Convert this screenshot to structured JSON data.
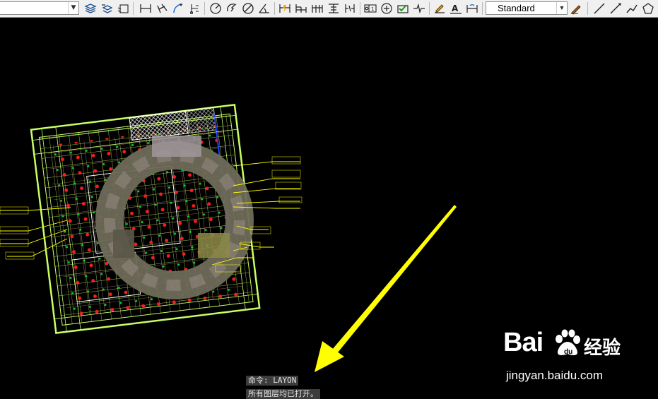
{
  "toolbar": {
    "text_style": "Standard",
    "icons": [
      "layer-properties-icon",
      "layer-previous-icon",
      "layer-state-icon",
      "dim-linear-icon",
      "dim-aligned-icon",
      "dim-arc-icon",
      "dim-ordinate-icon",
      "dim-radius-icon",
      "dim-jogged-icon",
      "dim-diameter-icon",
      "dim-angular-icon",
      "quick-dim-icon",
      "dim-baseline-icon",
      "dim-continue-icon",
      "dim-space-icon",
      "dim-break-icon",
      "tolerance-icon",
      "center-mark-icon",
      "dim-inspect-icon",
      "dim-jogged-linear-icon",
      "dim-edit-icon",
      "dim-text-edit-icon",
      "dim-update-icon",
      "dim-style-icon",
      "line-icon",
      "ray-icon",
      "polyline-icon",
      "polygon-icon"
    ]
  },
  "command_line": {
    "command": "命令: LAYON",
    "message": "所有图层均已打开。"
  },
  "watermark": {
    "logo": "Bai",
    "logo_suffix": "经验",
    "url": "jingyan.baidu.com"
  },
  "colors": {
    "background": "#000000",
    "drawing_green": "#c8ff64",
    "drawing_red": "#ff2020",
    "annotation_yellow": "#ffff00",
    "arrow_yellow": "#ffff00"
  }
}
